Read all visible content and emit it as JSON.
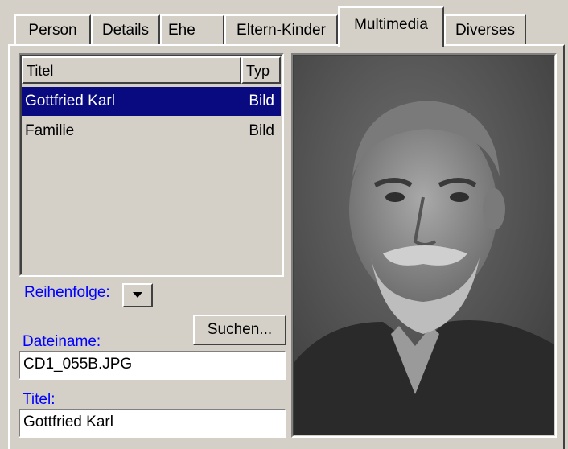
{
  "tabs": [
    "Person",
    "Details",
    "Ehe",
    "Eltern-Kinder",
    "Multimedia",
    "Diverses"
  ],
  "active_tab": "Multimedia",
  "list": {
    "columns": [
      "Titel",
      "Typ"
    ],
    "rows": [
      {
        "titel": "Gottfried Karl",
        "typ": "Bild",
        "selected": true
      },
      {
        "titel": "Familie",
        "typ": "Bild",
        "selected": false
      }
    ]
  },
  "order_label": "Reihenfolge:",
  "search_button": "Suchen...",
  "filename_label": "Dateiname:",
  "filename_value": "CD1_055B.JPG",
  "title_label": "Titel:",
  "title_value": "Gottfried Karl",
  "colors": {
    "selection": "#0a0a80",
    "label": "#0000ff",
    "face": "#d4d0c8"
  }
}
